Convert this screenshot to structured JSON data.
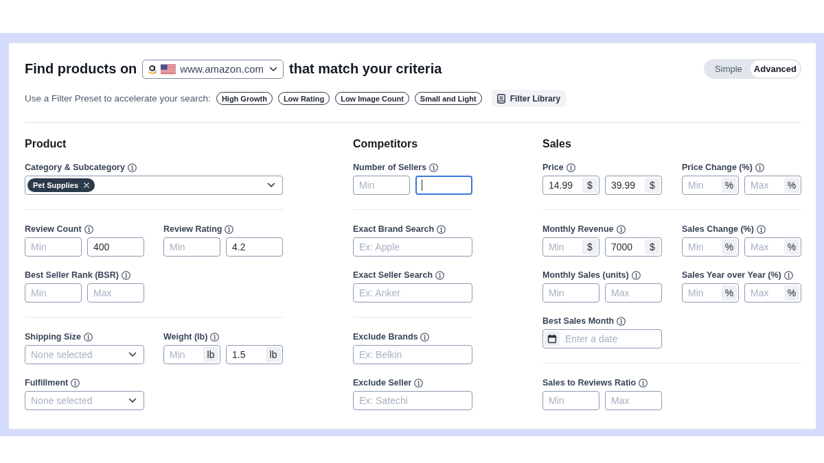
{
  "header": {
    "title_start": "Find products on",
    "marketplace": "www.amazon.com",
    "title_end": "that match your criteria"
  },
  "mode_toggle": [
    {
      "label": "Simple",
      "selected": false
    },
    {
      "label": "Advanced",
      "selected": true
    }
  ],
  "presets": {
    "label": "Use a Filter Preset to accelerate your search:",
    "chips": [
      "High Growth",
      "Low Rating",
      "Low Image Count",
      "Small and Light"
    ],
    "library_button": "Filter Library"
  },
  "sections": [
    {
      "title": "Product",
      "groups": [
        {
          "filters": [
            {
              "kind": "tags",
              "label": "Category & Subcategory",
              "tags": [
                "Pet Supplies"
              ]
            }
          ]
        },
        {
          "filters": [
            {
              "kind": "range",
              "label": "Review Count",
              "inputs": [
                {
                  "placeholder": "Min",
                  "focused": false
                },
                {
                  "value": "400",
                  "focused": false
                }
              ]
            },
            {
              "kind": "range",
              "label": "Review Rating",
              "inputs": [
                {
                  "placeholder": "Min",
                  "focused": false
                },
                {
                  "value": "4.2",
                  "focused": false
                }
              ]
            },
            {
              "kind": "range",
              "label": "Best Seller Rank (BSR)",
              "inputs": [
                {
                  "placeholder": "Min",
                  "focused": false
                },
                {
                  "placeholder": "Max",
                  "focused": false
                }
              ]
            }
          ]
        },
        {
          "filters": [
            {
              "kind": "select",
              "label": "Shipping Size",
              "placeholder": "None selected"
            },
            {
              "kind": "range",
              "label": "Weight (lb)",
              "inputs": [
                {
                  "placeholder": "Min",
                  "unit": "lb",
                  "focused": false
                },
                {
                  "value": "1.5",
                  "unit": "lb",
                  "focused": false
                }
              ]
            },
            {
              "kind": "select",
              "label": "Fulfillment",
              "placeholder": "None selected"
            }
          ]
        }
      ]
    },
    {
      "title": "Competitors",
      "groups": [
        {
          "filters": [
            {
              "kind": "range",
              "label": "Number of Sellers",
              "inputs": [
                {
                  "placeholder": "Min",
                  "focused": false
                },
                {
                  "focused": true
                }
              ]
            }
          ]
        },
        {
          "filters": [
            {
              "kind": "text",
              "label": "Exact Brand Search",
              "placeholder": "Ex: Apple"
            },
            {
              "kind": "text",
              "label": "Exact Seller Search",
              "placeholder": "Ex: Anker"
            }
          ]
        },
        {
          "filters": [
            {
              "kind": "text",
              "label": "Exclude Brands",
              "placeholder": "Ex: Belkin"
            },
            {
              "kind": "text",
              "label": "Exclude Seller",
              "placeholder": "Ex: Satechi"
            }
          ]
        }
      ]
    },
    {
      "title": "Sales",
      "groups": [
        {
          "filters": [
            {
              "kind": "range",
              "label": "Price",
              "inputs": [
                {
                  "value": "14.99",
                  "unit": "$",
                  "focused": false
                },
                {
                  "value": "39.99",
                  "unit": "$",
                  "focused": false
                }
              ]
            },
            {
              "kind": "range",
              "label": "Price Change (%)",
              "inputs": [
                {
                  "placeholder": "Min",
                  "unit": "%",
                  "focused": false
                },
                {
                  "placeholder": "Max",
                  "unit": "%",
                  "focused": false
                }
              ]
            }
          ]
        },
        {
          "filters": [
            {
              "kind": "range",
              "label": "Monthly Revenue",
              "inputs": [
                {
                  "placeholder": "Min",
                  "unit": "$",
                  "focused": false
                },
                {
                  "value": "7000",
                  "unit": "$",
                  "focused": false
                }
              ]
            },
            {
              "kind": "range",
              "label": "Sales Change (%)",
              "inputs": [
                {
                  "placeholder": "Min",
                  "unit": "%",
                  "focused": false
                },
                {
                  "placeholder": "Max",
                  "unit": "%",
                  "focused": false
                }
              ]
            },
            {
              "kind": "range",
              "label": "Monthly Sales (units)",
              "inputs": [
                {
                  "placeholder": "Min",
                  "focused": false
                },
                {
                  "placeholder": "Max",
                  "focused": false
                }
              ]
            },
            {
              "kind": "range",
              "label": "Sales Year over Year (%)",
              "inputs": [
                {
                  "placeholder": "Min",
                  "unit": "%",
                  "focused": false
                },
                {
                  "placeholder": "Max",
                  "unit": "%",
                  "focused": false
                }
              ]
            },
            {
              "kind": "date",
              "label": "Best Sales Month",
              "placeholder": "Enter a date"
            }
          ]
        },
        {
          "filters": [
            {
              "kind": "range",
              "label": "Sales to Reviews Ratio",
              "inputs": [
                {
                  "placeholder": "Min",
                  "focused": false
                },
                {
                  "placeholder": "Max",
                  "focused": false
                }
              ]
            }
          ]
        }
      ]
    }
  ]
}
